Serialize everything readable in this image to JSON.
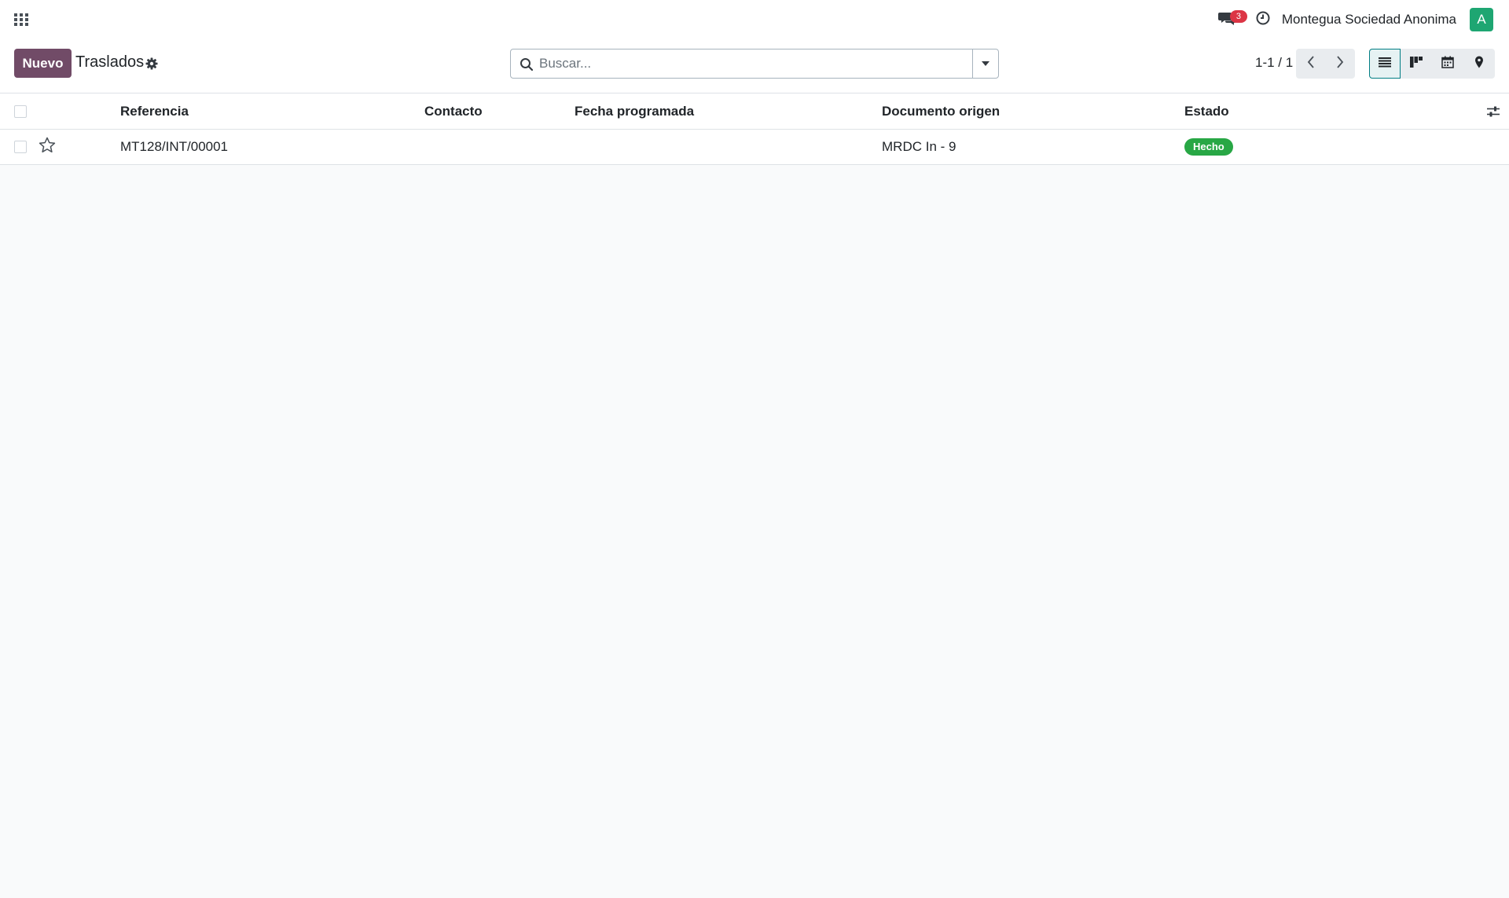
{
  "navbar": {
    "apps_icon": "grid-apps-icon",
    "chat_icon": "chat-bubbles-icon",
    "chat_badge": "3",
    "activity_icon": "clock-icon",
    "company": "Montegua Sociedad Anonima",
    "avatar_letter": "A",
    "avatar_color": "#1ea672"
  },
  "control_panel": {
    "new_button": "Nuevo",
    "title": "Traslados",
    "settings_icon": "gear-icon",
    "search": {
      "placeholder": "Buscar...",
      "value": ""
    },
    "pager": "1-1 / 1",
    "views": [
      "list",
      "kanban",
      "calendar",
      "map"
    ],
    "active_view": "list"
  },
  "table": {
    "columns": [
      "Referencia",
      "Contacto",
      "Fecha programada",
      "Documento origen",
      "Estado"
    ],
    "rows": [
      {
        "referencia": "MT128/INT/00001",
        "contacto": "",
        "fecha_programada": "",
        "documento_origen": "MRDC In - 9",
        "estado": "Hecho",
        "favorite": false
      }
    ]
  },
  "colors": {
    "primary": "#714b67",
    "success": "#28a745",
    "danger": "#dc3545",
    "active_view": "#017e84"
  }
}
